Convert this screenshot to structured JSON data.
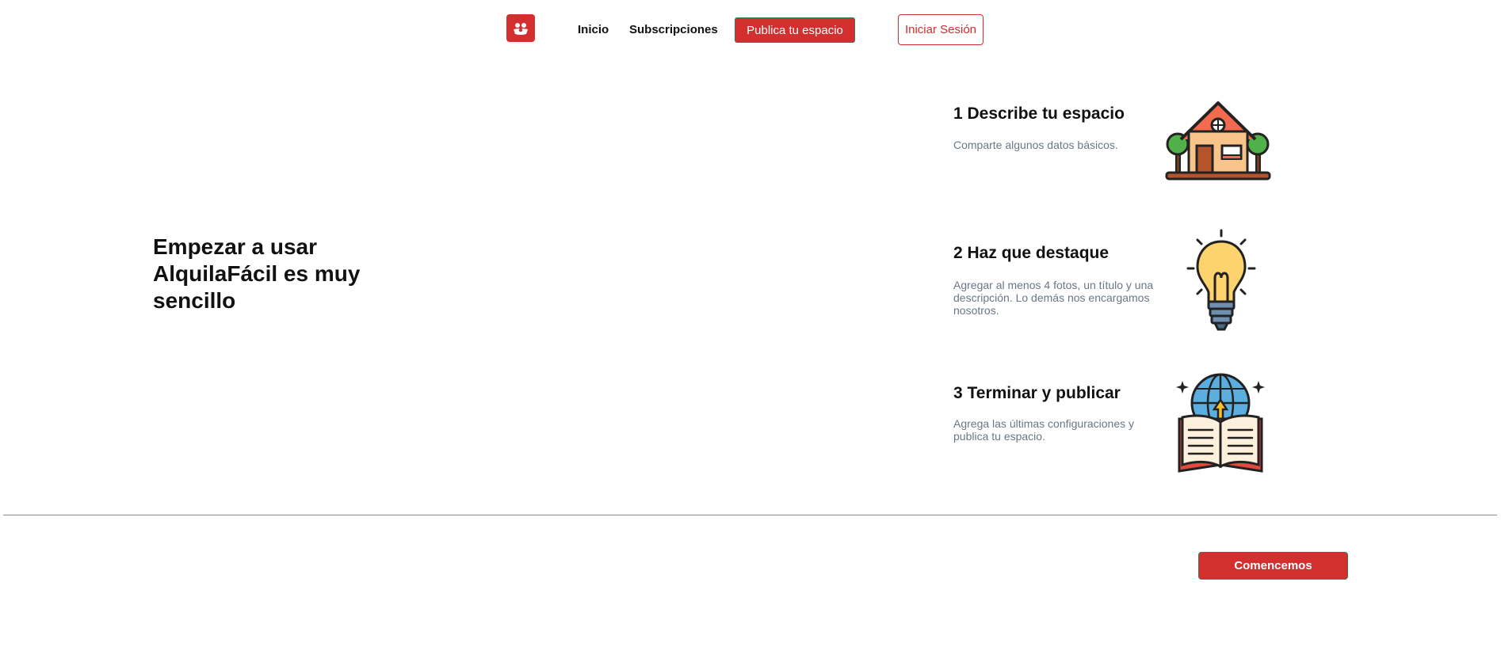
{
  "nav": {
    "logo_icon": "people-icon",
    "links": [
      {
        "label": "Inicio"
      },
      {
        "label": "Subscripciones"
      }
    ],
    "publish_label": "Publica tu espacio",
    "login_label": "Iniciar Sesión"
  },
  "hero": {
    "title": "Empezar a usar AlquilaFácil es muy sencillo"
  },
  "steps": [
    {
      "title": "1 Describe tu espacio",
      "description": "Comparte algunos datos básicos.",
      "icon": "house-icon"
    },
    {
      "title": "2 Haz que destaque",
      "description": "Agregar al menos 4 fotos, un título y una descripción. Lo demás nos encargamos nosotros.",
      "icon": "lightbulb-icon"
    },
    {
      "title": "3 Terminar y publicar",
      "description": "Agrega las últimas configuraciones y publica tu espacio.",
      "icon": "book-globe-icon"
    }
  ],
  "cta": {
    "label": "Comencemos"
  },
  "colors": {
    "brand_red": "#d32f2f",
    "button_border": "#2e7d55",
    "muted_text": "#6b7785"
  }
}
